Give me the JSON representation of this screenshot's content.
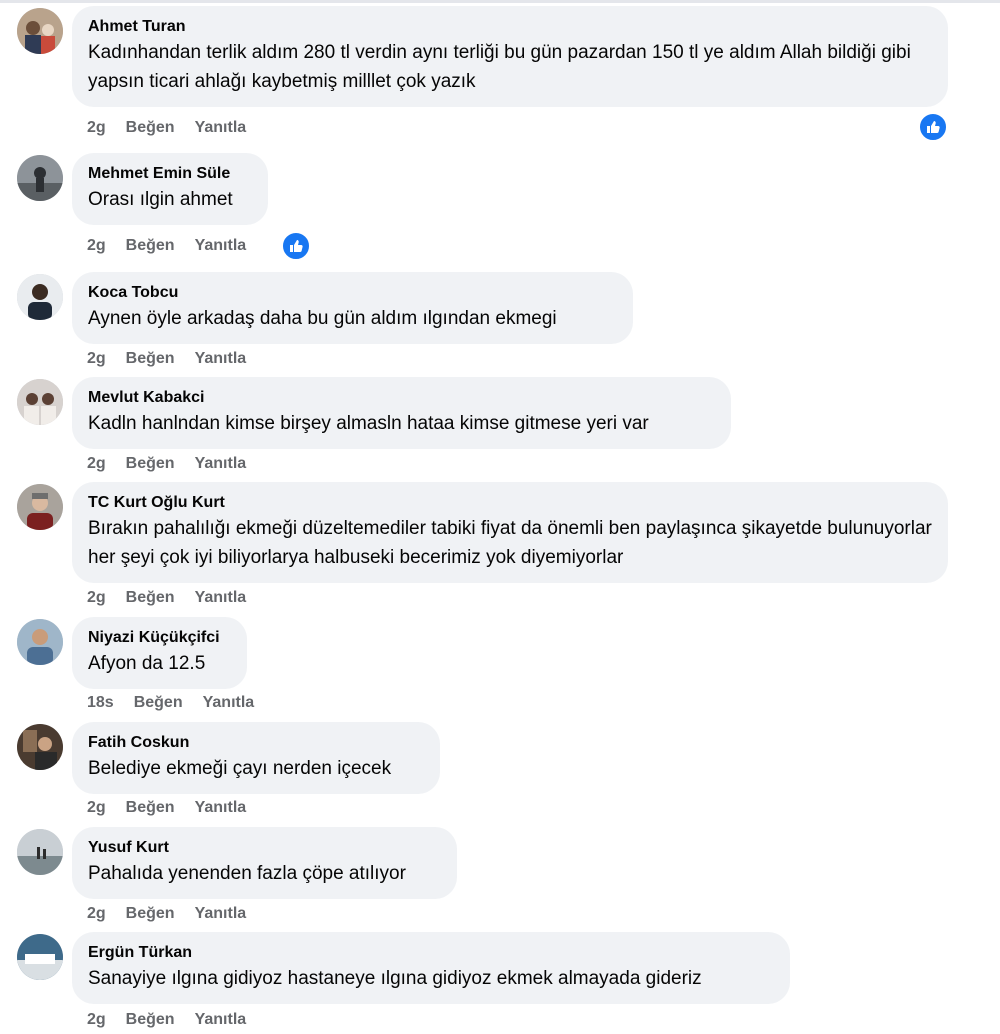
{
  "comments": [
    {
      "author": "Ahmet Turan",
      "text": "Kadınhandan terlik aldım 280 tl verdin aynı terliği bu gün pazardan 150 tl ye aldım Allah bildiği gibi yapsın ticari ahlağı kaybetmiş milllet çok yazık",
      "time": "2g",
      "like": "Beğen",
      "reply": "Yanıtla"
    },
    {
      "author": "Mehmet Emin Süle",
      "text": "Orası ılgin ahmet",
      "time": "2g",
      "like": "Beğen",
      "reply": "Yanıtla"
    },
    {
      "author": "Koca Tobcu",
      "text": "Aynen öyle arkadaş daha bu gün aldım ılgından ekmegi",
      "time": "2g",
      "like": "Beğen",
      "reply": "Yanıtla"
    },
    {
      "author": "Mevlut Kabakci",
      "text": "Kadln hanlndan kimse birşey almasln hataa kimse gitmese yeri var",
      "time": "2g",
      "like": "Beğen",
      "reply": "Yanıtla"
    },
    {
      "author": "TC Kurt Oğlu Kurt",
      "text": "Bırakın pahalılığı ekmeği düzeltemediler tabiki fiyat da önemli ben paylaşınca şikayetde bulunuyorlar her şeyi çok iyi biliyorlarya halbuseki becerimiz yok diyemiyorlar",
      "time": "2g",
      "like": "Beğen",
      "reply": "Yanıtla"
    },
    {
      "author": "Niyazi Küçükçifci",
      "text": "Afyon da 12.5",
      "time": "18s",
      "like": "Beğen",
      "reply": "Yanıtla"
    },
    {
      "author": "Fatih Coskun",
      "text": "Belediye ekmeği çayı nerden içecek",
      "time": "2g",
      "like": "Beğen",
      "reply": "Yanıtla"
    },
    {
      "author": "Yusuf Kurt",
      "text": "Pahalıda yenenden fazla çöpe atılıyor",
      "time": "2g",
      "like": "Beğen",
      "reply": "Yanıtla"
    },
    {
      "author": "Ergün Türkan",
      "text": "Sanayiye ılgına gidiyoz hastaneye ılgına gidiyoz ekmek almayada gideriz",
      "time": "2g",
      "like": "Beğen",
      "reply": "Yanıtla"
    }
  ],
  "icons": {
    "reaction": "like-thumb-icon"
  },
  "colors": {
    "accent": "#1877f2",
    "bubble": "#f0f2f5",
    "meta": "#65676b"
  }
}
